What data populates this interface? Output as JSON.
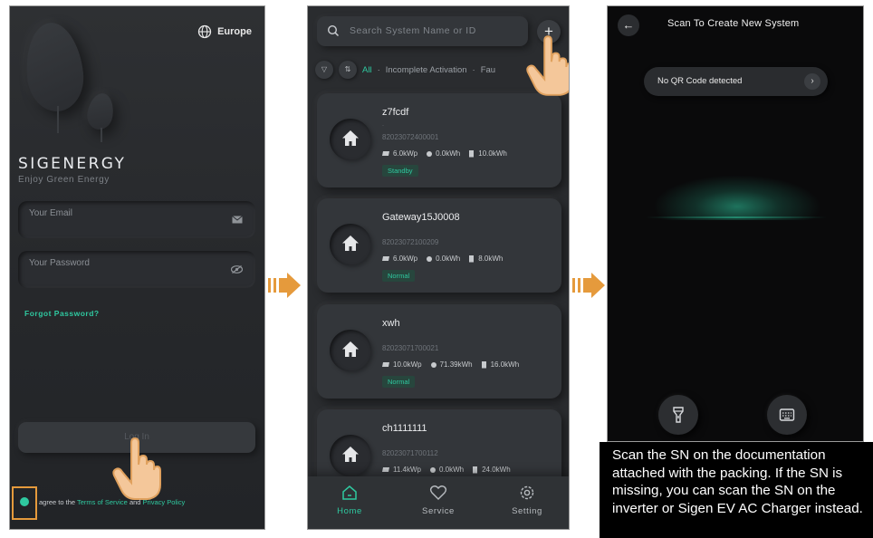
{
  "login_screen": {
    "region": "Europe",
    "logo": "SIGENERGY",
    "tagline": "Enjoy Green Energy",
    "email_placeholder": "Your Email",
    "password_placeholder": "Your Password",
    "forgot_password": "Forgot Password?",
    "login_button": "Log In",
    "agree_prefix": "agree to the",
    "terms_link": "Terms of Service",
    "and": "and",
    "privacy_link": "Privacy Policy"
  },
  "systems_screen": {
    "search_placeholder": "Search System Name or ID",
    "add_button": "+",
    "filter_tabs": [
      "All",
      "Incomplete Activation",
      "Fau"
    ],
    "systems": [
      {
        "name": "z7fcdf",
        "dot": "·",
        "sn": "82023072400001",
        "pv": "6.0kWp",
        "energy": "0.0kWh",
        "battery": "10.0kWh",
        "status": "Standby"
      },
      {
        "name": "Gateway15J0008",
        "dot": "",
        "sn": "82023072100209",
        "pv": "6.0kWp",
        "energy": "0.0kWh",
        "battery": "8.0kWh",
        "status": "Normal"
      },
      {
        "name": "xwh",
        "dot": "",
        "sn": "82023071700021",
        "pv": "10.0kWp",
        "energy": "71.39kWh",
        "battery": "16.0kWh",
        "status": "Normal"
      },
      {
        "name": "ch1111111",
        "dot": "",
        "sn": "82023071700112",
        "pv": "11.4kWp",
        "energy": "0.0kWh",
        "battery": "24.0kWh",
        "status": ""
      }
    ],
    "nav": {
      "home": "Home",
      "service": "Service",
      "setting": "Setting"
    }
  },
  "scan_screen": {
    "title": "Scan To Create New System",
    "qr_status": "No QR Code detected",
    "back_icon": "arrow-left-icon",
    "flashlight_icon": "flashlight-icon",
    "keyboard_icon": "keyboard-icon"
  },
  "caption": "Scan the SN on the documentation attached with the packing. If the SN is missing, you can scan the SN on the inverter or Sigen EV AC Charger instead.",
  "colors": {
    "accent": "#2fc9a0",
    "highlight": "#e59a3c"
  }
}
